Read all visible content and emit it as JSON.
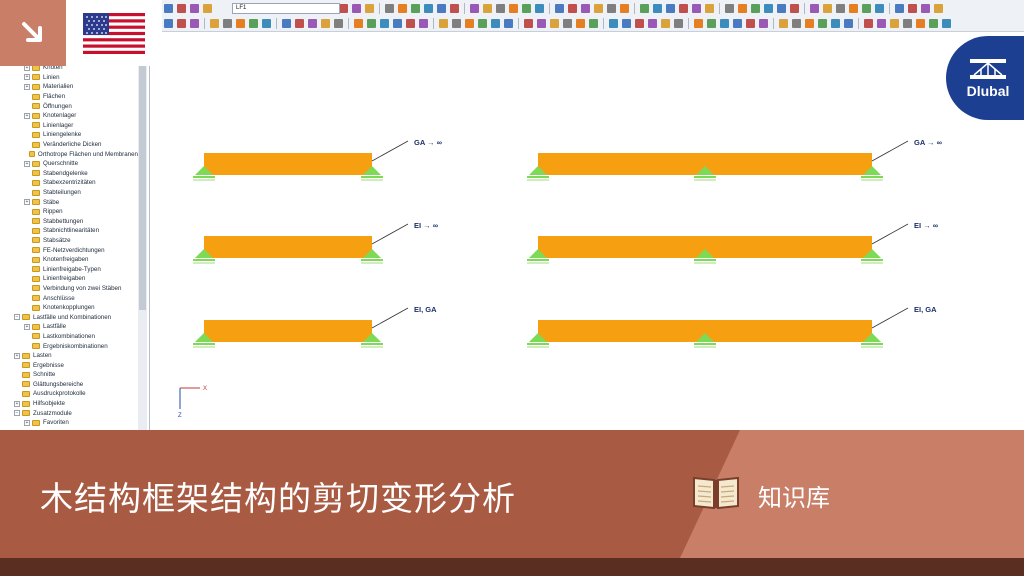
{
  "toolbar": {
    "load_case": "LF1"
  },
  "navigator": {
    "items": [
      {
        "label": "Knoten",
        "level": 2,
        "twisty": "+"
      },
      {
        "label": "Linien",
        "level": 2,
        "twisty": "+"
      },
      {
        "label": "Materialien",
        "level": 2,
        "twisty": "+"
      },
      {
        "label": "Flächen",
        "level": 2,
        "twisty": ""
      },
      {
        "label": "Öffnungen",
        "level": 2,
        "twisty": ""
      },
      {
        "label": "Knotenlager",
        "level": 2,
        "twisty": "+"
      },
      {
        "label": "Linienlager",
        "level": 2,
        "twisty": ""
      },
      {
        "label": "Liniengelenke",
        "level": 2,
        "twisty": ""
      },
      {
        "label": "Veränderliche Dicken",
        "level": 2,
        "twisty": ""
      },
      {
        "label": "Orthotrope Flächen und Membranen",
        "level": 2,
        "twisty": ""
      },
      {
        "label": "Querschnitte",
        "level": 2,
        "twisty": "+"
      },
      {
        "label": "Stabendgelenke",
        "level": 2,
        "twisty": ""
      },
      {
        "label": "Stabexzentrizitäten",
        "level": 2,
        "twisty": ""
      },
      {
        "label": "Stabteilungen",
        "level": 2,
        "twisty": ""
      },
      {
        "label": "Stäbe",
        "level": 2,
        "twisty": "+"
      },
      {
        "label": "Rippen",
        "level": 2,
        "twisty": ""
      },
      {
        "label": "Stabbettungen",
        "level": 2,
        "twisty": ""
      },
      {
        "label": "Stabnichtlinearitäten",
        "level": 2,
        "twisty": ""
      },
      {
        "label": "Stabsätze",
        "level": 2,
        "twisty": ""
      },
      {
        "label": "FE-Netzverdichtungen",
        "level": 2,
        "twisty": ""
      },
      {
        "label": "Knotenfreigaben",
        "level": 2,
        "twisty": ""
      },
      {
        "label": "Linienfreigabe-Typen",
        "level": 2,
        "twisty": ""
      },
      {
        "label": "Linienfreigaben",
        "level": 2,
        "twisty": ""
      },
      {
        "label": "Verbindung von zwei Stäben",
        "level": 2,
        "twisty": ""
      },
      {
        "label": "Anschlüsse",
        "level": 2,
        "twisty": ""
      },
      {
        "label": "Knotenkopplungen",
        "level": 2,
        "twisty": ""
      },
      {
        "label": "Lastfälle und Kombinationen",
        "level": 1,
        "twisty": "−"
      },
      {
        "label": "Lastfälle",
        "level": 2,
        "twisty": "+"
      },
      {
        "label": "Lastkombinationen",
        "level": 2,
        "twisty": ""
      },
      {
        "label": "Ergebniskombinationen",
        "level": 2,
        "twisty": ""
      },
      {
        "label": "Lasten",
        "level": 1,
        "twisty": "+"
      },
      {
        "label": "Ergebnisse",
        "level": 1,
        "twisty": ""
      },
      {
        "label": "Schnitte",
        "level": 1,
        "twisty": ""
      },
      {
        "label": "Glättungsbereiche",
        "level": 1,
        "twisty": ""
      },
      {
        "label": "Ausdruckprotokolle",
        "level": 1,
        "twisty": ""
      },
      {
        "label": "Hilfsobjekte",
        "level": 1,
        "twisty": "+"
      },
      {
        "label": "Zusatzmodule",
        "level": 1,
        "twisty": "−"
      },
      {
        "label": "Favoriten",
        "level": 2,
        "twisty": "+"
      }
    ]
  },
  "canvas": {
    "beam_labels": [
      "GA → ∞",
      "GA → ∞",
      "EI → ∞",
      "EI → ∞",
      "EI, GA",
      "EI, GA"
    ],
    "axis_x": "X",
    "axis_z": "Z"
  },
  "logo": {
    "text": "Dlubal"
  },
  "banner": {
    "title": "木结构框架结构的剪切变形分析",
    "kb_label": "知识库"
  },
  "colors": {
    "beam": "#f6a011",
    "support": "#7ed957",
    "brand_blue": "#1c3f91",
    "banner_dark": "#a85a42",
    "banner_light": "#c97e68"
  }
}
